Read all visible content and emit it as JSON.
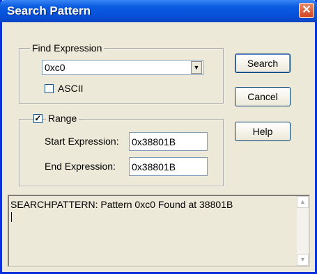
{
  "window": {
    "title": "Search Pattern",
    "close_glyph": "✕"
  },
  "find_expression": {
    "legend": "Find Expression",
    "value": "0xc0",
    "ascii_label": "ASCII",
    "ascii_checked": false
  },
  "range": {
    "legend": "Range",
    "checked": true,
    "start_label": "Start Expression:",
    "start_value": "0x38801B",
    "end_label": "End Expression:",
    "end_value": "0x38801B"
  },
  "buttons": {
    "search": "Search",
    "cancel": "Cancel",
    "help": "Help"
  },
  "output": {
    "text": "SEARCHPATTERN: Pattern 0xc0 Found at 38801B"
  },
  "colors": {
    "titlebar": "#0a5ce0",
    "window_bg": "#ece9d8",
    "close_button": "#d1451f"
  },
  "icons": {
    "dropdown": "chevron-down-icon",
    "check": "checkmark-icon"
  }
}
